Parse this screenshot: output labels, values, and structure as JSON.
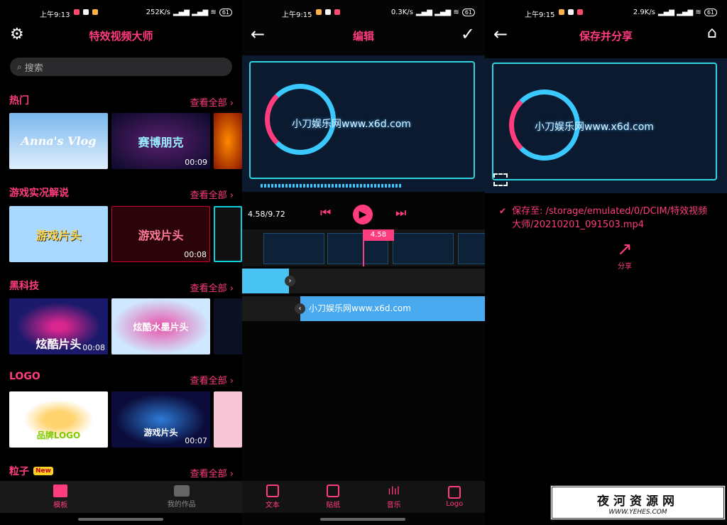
{
  "status_bars": [
    {
      "time": "上午9:13",
      "speed": "252K/s",
      "battery": "61"
    },
    {
      "time": "上午9:15",
      "speed": "0.3K/s",
      "battery": "61"
    },
    {
      "time": "上午9:15",
      "speed": "2.9K/s",
      "battery": "61"
    }
  ],
  "home": {
    "title": "特效视频大师",
    "search_placeholder": "搜索",
    "sections": [
      {
        "title": "热门",
        "see_all": "查看全部 ›",
        "items": [
          {
            "text": "Anna's Vlog",
            "duration": ""
          },
          {
            "text": "赛博朋克",
            "duration": "00:09"
          }
        ]
      },
      {
        "title": "游戏实况解说",
        "see_all": "查看全部 ›",
        "items": [
          {
            "text": "游戏片头",
            "duration": ""
          },
          {
            "text": "游戏片头",
            "duration": "00:08"
          }
        ]
      },
      {
        "title": "黑科技",
        "see_all": "查看全部 ›",
        "items": [
          {
            "text": "炫酷片头",
            "duration": "00:08"
          },
          {
            "text": "炫酷水墨片头",
            "duration": ""
          }
        ]
      },
      {
        "title": "LOGO",
        "see_all": "查看全部 ›",
        "items": [
          {
            "text": "品牌LOGO",
            "duration": ""
          },
          {
            "text": "游戏片头",
            "duration": "00:07"
          }
        ]
      },
      {
        "title": "粒子",
        "badge": "New",
        "see_all": "查看全部 ›",
        "items": []
      }
    ],
    "nav": [
      {
        "label": "模板",
        "icon": "film-icon"
      },
      {
        "label": "我的作品",
        "icon": "camera-icon"
      }
    ]
  },
  "editor": {
    "title": "编辑",
    "preview_text": "小刀娱乐网www.x6d.com",
    "time_display": "4.58/9.72",
    "playhead_label": "4.58",
    "text_track_label": "小刀娱乐网www.x6d.com",
    "nav": [
      {
        "label": "文本",
        "icon": "text-icon"
      },
      {
        "label": "贴纸",
        "icon": "sticker-icon"
      },
      {
        "label": "音乐",
        "icon": "music-icon"
      },
      {
        "label": "Logo",
        "icon": "logo-icon"
      }
    ]
  },
  "share": {
    "title": "保存并分享",
    "preview_text": "小刀娱乐网www.x6d.com",
    "saved_path": "保存至: /storage/emulated/0/DCIM/特效视频大师/20210201_091503.mp4",
    "share_label": "分享"
  },
  "watermark": {
    "text": "夜河资源网",
    "url": "WWW.YEHES.COM"
  },
  "colors": {
    "accent": "#ff3c7d",
    "cyan": "#3ac8ff"
  }
}
